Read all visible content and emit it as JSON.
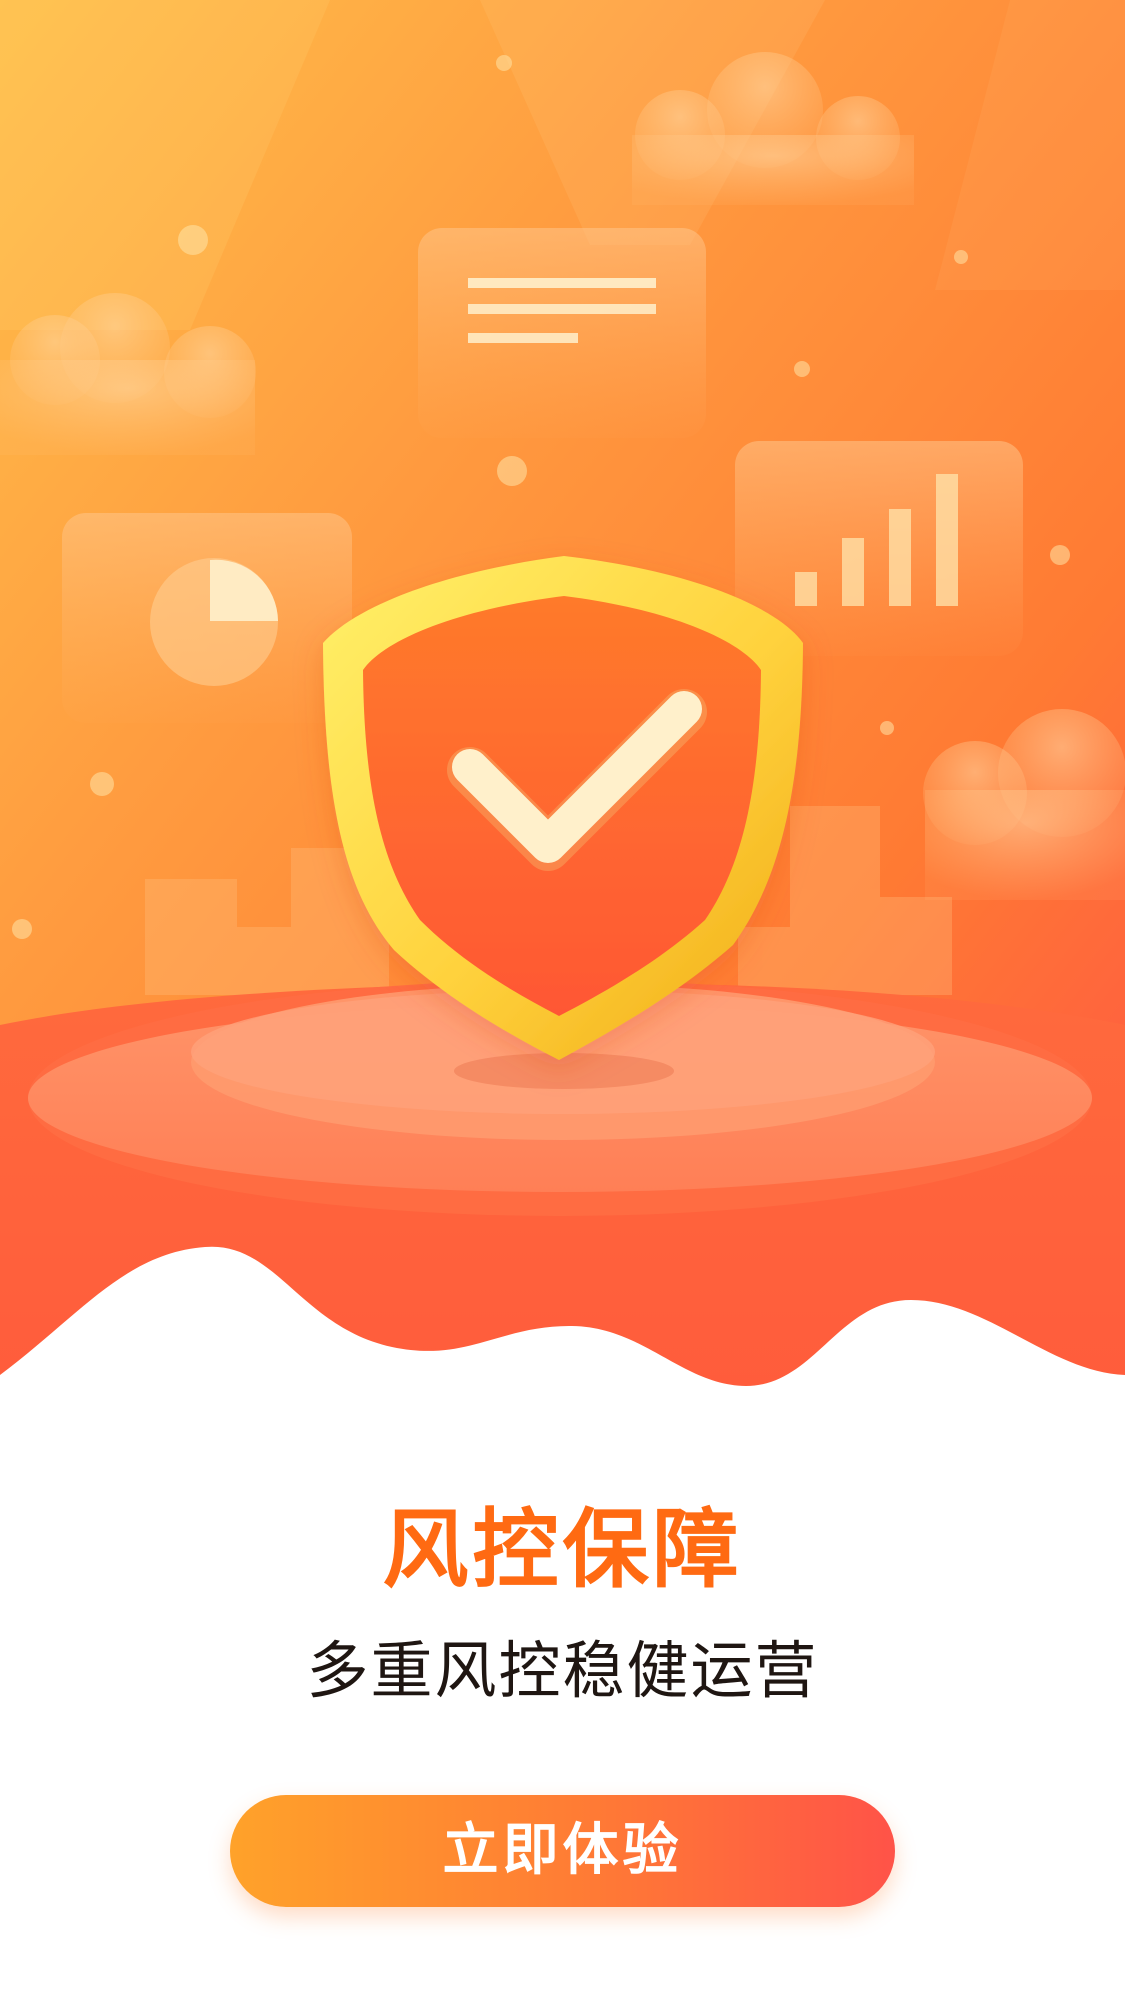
{
  "hero": {
    "illustration_icon": "shield-check-icon"
  },
  "content": {
    "title": "风控保障",
    "subtitle": "多重风控稳健运营"
  },
  "cta": {
    "label": "立即体验"
  },
  "colors": {
    "title": "#ff6a12",
    "subtitle": "#1f1612",
    "button_start": "#ffa22a",
    "button_end": "#ff5348",
    "button_text": "#ffffff"
  }
}
